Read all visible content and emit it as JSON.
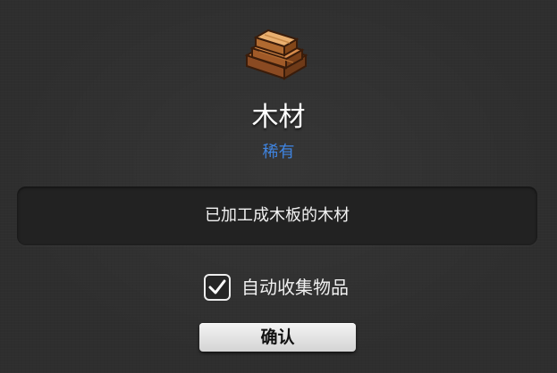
{
  "item": {
    "icon": "wood-planks-icon",
    "name": "木材",
    "rarity": "稀有",
    "rarity_color": "#3f84e0",
    "description": "已加工成木板的木材"
  },
  "options": {
    "auto_collect_label": "自动收集物品",
    "auto_collect_checked": true
  },
  "buttons": {
    "confirm_label": "确认"
  }
}
